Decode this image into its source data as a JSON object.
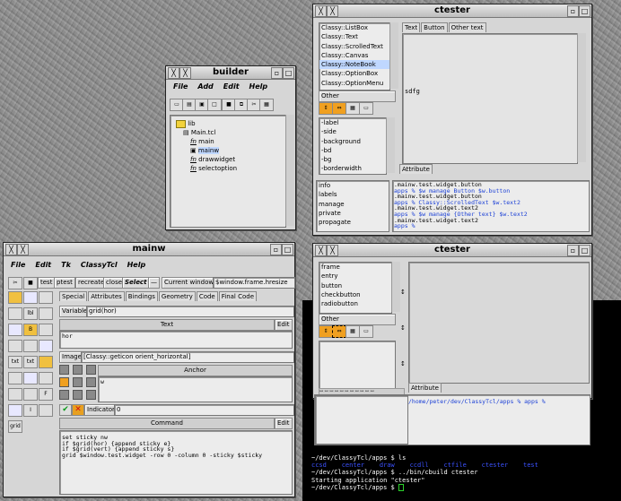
{
  "builder": {
    "title": "builder",
    "menu": [
      "File",
      "Add",
      "Edit",
      "Help"
    ],
    "tree": [
      "lib",
      "Main.tcl",
      "main",
      "mainw",
      "drawwidget",
      "selectoption"
    ]
  },
  "ctester1": {
    "title": "ctester",
    "classes": [
      "Classy::ListBox",
      "Classy::Text",
      "Classy::ScrolledText",
      "Classy::Canvas",
      "Classy::NoteBook",
      "Classy::OptionBox",
      "Classy::OptionMenu"
    ],
    "other_label": "Other",
    "options": [
      "-label",
      "-side",
      "-background",
      "-bd",
      "-bg",
      "-borderwidth"
    ],
    "tabs": [
      "Text",
      "Button",
      "Other text"
    ],
    "content1": "sdfg",
    "content2": "sdfg",
    "attribute_label": "Attribute",
    "cmds": [
      "info",
      "labels",
      "manage",
      "private",
      "propagate"
    ],
    "console": [
      {
        "t": ".mainw.test.widget.button",
        "c": "#000"
      },
      {
        "t": "apps % $w manage Button $w.button",
        "c": "#1a3fd6"
      },
      {
        "t": ".mainw.test.widget.button",
        "c": "#000"
      },
      {
        "t": "apps % Classy::ScrolledText $w.text2",
        "c": "#1a3fd6"
      },
      {
        "t": ".mainw.test.widget.text2",
        "c": "#000"
      },
      {
        "t": "apps % $w manage {Other text} $w.text2",
        "c": "#1a3fd6"
      },
      {
        "t": ".mainw.test.widget.text2",
        "c": "#000"
      },
      {
        "t": "apps %",
        "c": "#1a3fd6"
      }
    ]
  },
  "ctester2": {
    "title": "ctester",
    "classes": [
      "frame",
      "entry",
      "button",
      "checkbutton",
      "radiobutton"
    ],
    "other_label": "Other",
    "attribute_label": "Attribute",
    "console": "/home/peter/dev/ClassyTcl/apps % apps %"
  },
  "mainw": {
    "title": "mainw",
    "menu": [
      "File",
      "Edit",
      "Tk",
      "ClassyTcl",
      "Help"
    ],
    "toolbar": [
      "test",
      "ptest",
      "recreate",
      "close",
      "Select",
      "Current window",
      "$window.frame.hresize"
    ],
    "tabs": [
      "Special",
      "Attributes",
      "Bindings",
      "Geometry",
      "Code",
      "Final Code"
    ],
    "variable_label": "Variable",
    "variable_value": "grid(hor)",
    "text_header": "Text",
    "edit_label": "Edit",
    "text_value": "hor",
    "image_label": "Image",
    "image_value": "[Classy::geticon orient_horizontal]",
    "anchor_label": "Anchor",
    "anchor_value": "w",
    "indicator_label": "Indicator",
    "indicator_value": "0",
    "command_header": "Command",
    "command_edit": "Edit",
    "command_lines": [
      "set sticky nw",
      "if $grid(hor) {append sticky e}",
      "if $grid(vert) {append sticky s}",
      "grid $window.test.widget -row 0 -column 0 -sticky $sticky"
    ],
    "side_tools": [
      "",
      "",
      "",
      "",
      "lbl",
      "",
      "",
      "B",
      "",
      "",
      "",
      "",
      "txt",
      "txt",
      "",
      "",
      "",
      "",
      "",
      "",
      "F",
      "",
      "I",
      "",
      "grid"
    ]
  },
  "terminal": {
    "lines": [
      {
        "t": "~/dev/ClassyTcl/apps $ ls",
        "c": "#ffffff"
      },
      {
        "t": "ccsd    center    draw    ccdll    ctfile    ctester    test",
        "c": "#3b52ff"
      },
      {
        "t": "~/dev/ClassyTcl/apps $ ../bin/cbuild ctester",
        "c": "#ffffff"
      },
      {
        "t": "Starting application \"ctester\"",
        "c": "#ffffff"
      },
      {
        "t": "~/dev/ClassyTcl/apps $ ",
        "c": "#ffffff"
      }
    ]
  }
}
